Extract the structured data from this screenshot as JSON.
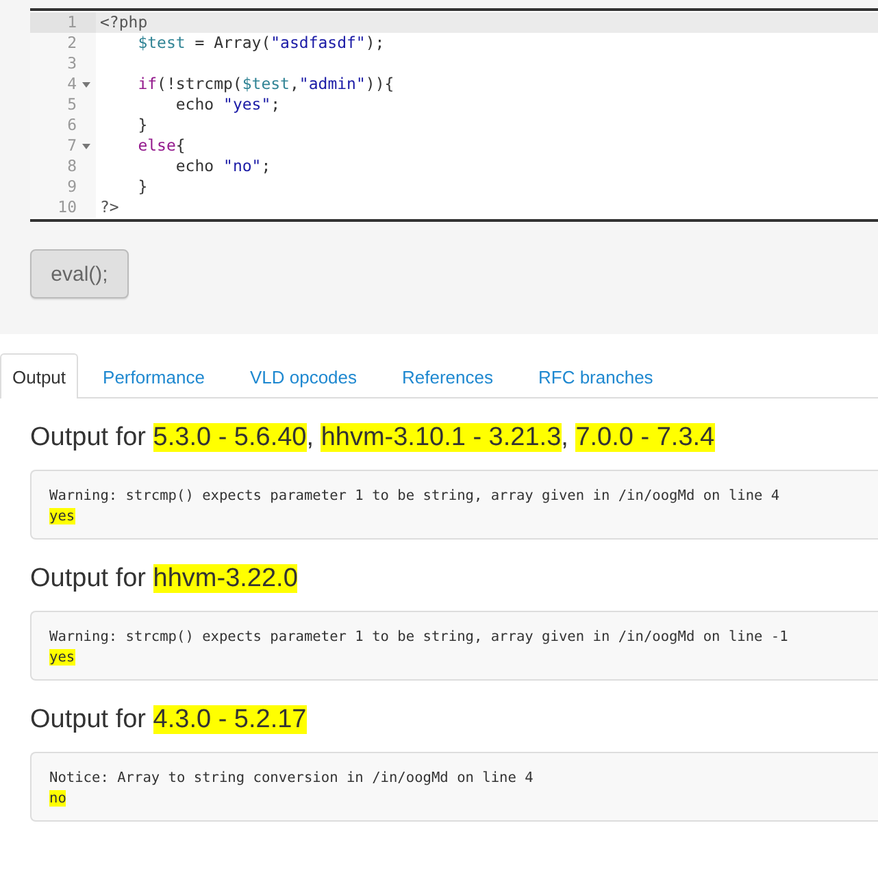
{
  "editor": {
    "lines": [
      {
        "number": "1",
        "fold": false,
        "active": true,
        "tokens": [
          {
            "text": "<?php",
            "kind": "tag"
          }
        ]
      },
      {
        "number": "2",
        "fold": false,
        "active": false,
        "tokens": [
          {
            "text": "    $test",
            "kind": "var"
          },
          {
            "text": " = Array(",
            "kind": "plain"
          },
          {
            "text": "\"asdfasdf\"",
            "kind": "string"
          },
          {
            "text": ");",
            "kind": "plain"
          }
        ]
      },
      {
        "number": "3",
        "fold": false,
        "active": false
      },
      {
        "number": "4",
        "fold": true,
        "active": false,
        "tokens": [
          {
            "text": "    if",
            "kind": "keyword"
          },
          {
            "text": "(!strcmp(",
            "kind": "plain"
          },
          {
            "text": "$test",
            "kind": "var"
          },
          {
            "lead": ",",
            "text": "\"admin\"",
            "kind": "string"
          },
          {
            "text": ")){",
            "kind": "plain"
          }
        ]
      },
      {
        "number": "5",
        "fold": false,
        "active": false,
        "tokens": [
          {
            "text": "        echo ",
            "kind": "plain"
          },
          {
            "text": "\"yes\"",
            "kind": "string"
          },
          {
            "text": ";",
            "kind": "plain"
          }
        ]
      },
      {
        "number": "6",
        "fold": false,
        "active": false,
        "tokens": [
          {
            "text": "    }",
            "kind": "plain"
          }
        ]
      },
      {
        "number": "7",
        "fold": true,
        "active": false,
        "tokens": [
          {
            "text": "    else",
            "kind": "keyword"
          },
          {
            "text": "{",
            "kind": "plain"
          }
        ]
      },
      {
        "number": "8",
        "fold": false,
        "active": false,
        "tokens": [
          {
            "text": "        echo ",
            "kind": "plain"
          },
          {
            "text": "\"no\"",
            "kind": "string"
          },
          {
            "text": ";",
            "kind": "plain"
          }
        ]
      },
      {
        "number": "9",
        "fold": false,
        "active": false,
        "tokens": [
          {
            "text": "    }",
            "kind": "plain"
          }
        ]
      },
      {
        "number": "10",
        "fold": false,
        "active": false,
        "tokens": [
          {
            "text": "?>",
            "kind": "tag"
          }
        ]
      }
    ]
  },
  "eval_button": "eval();",
  "tabs": [
    {
      "label": "Output",
      "selected": true
    },
    {
      "label": "Performance",
      "selected": false
    },
    {
      "label": "VLD opcodes",
      "selected": false
    },
    {
      "label": "References",
      "selected": false
    },
    {
      "label": "RFC branches",
      "selected": false
    }
  ],
  "outputs": [
    {
      "heading": [
        {
          "text": "Output for ",
          "highlighted": false
        },
        {
          "text": "5.3.0 - 5.6.40",
          "highlighted": true
        },
        {
          "lead": ", ",
          "text": "hhvm-3.10.1 - 3.21.3",
          "highlighted": true
        },
        {
          "lead": ", ",
          "text": "7.0.0 - 7.3.4",
          "highlighted": true
        }
      ],
      "lines": [
        {
          "text": "Warning: strcmp() expects parameter 1 to be string, array given in /in/oogMd on line 4",
          "highlighted": false
        },
        {
          "text": "yes",
          "highlighted": true
        }
      ]
    },
    {
      "heading": [
        {
          "text": "Output for ",
          "highlighted": false
        },
        {
          "text": "hhvm-3.22.0",
          "highlighted": true
        }
      ],
      "lines": [
        {
          "text": "Warning: strcmp() expects parameter 1 to be string, array given in /in/oogMd on line -1",
          "highlighted": false
        },
        {
          "text": "yes",
          "highlighted": true
        }
      ]
    },
    {
      "heading": [
        {
          "text": "Output for ",
          "highlighted": false
        },
        {
          "text": "4.3.0 - 5.2.17",
          "highlighted": true
        }
      ],
      "lines": [
        {
          "text": "Notice: Array to string conversion in /in/oogMd on line 4",
          "highlighted": false
        },
        {
          "text": "no",
          "highlighted": true
        }
      ]
    }
  ]
}
